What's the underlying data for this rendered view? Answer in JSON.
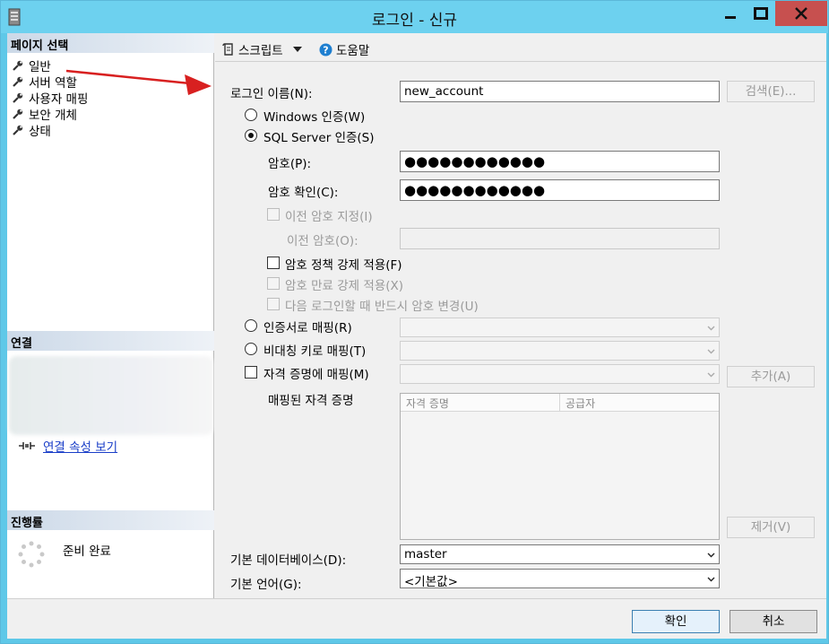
{
  "window": {
    "title": "로그인 - 신규",
    "colors": {
      "titlebar": "#6dd1ef",
      "close": "#c7504f",
      "arrow": "#d82020"
    }
  },
  "left": {
    "page_select_title": "페이지 선택",
    "pages": [
      {
        "label": "일반",
        "icon": "wrench-icon"
      },
      {
        "label": "서버 역할",
        "icon": "wrench-icon"
      },
      {
        "label": "사용자 매핑",
        "icon": "wrench-icon"
      },
      {
        "label": "보안 개체",
        "icon": "wrench-icon"
      },
      {
        "label": "상태",
        "icon": "wrench-icon"
      }
    ],
    "connection_title": "연결",
    "view_connection_link": "연결 속성 보기",
    "progress_title": "진행률",
    "progress_status": "준비 완료"
  },
  "toolbar": {
    "script_label": "스크립트",
    "help_label": "도움말"
  },
  "form": {
    "login_name_label": "로그인 이름(N):",
    "login_name_value": "new_account",
    "search_button": "검색(E)...",
    "windows_auth_label": "Windows 인증(W)",
    "sql_auth_label": "SQL Server 인증(S)",
    "password_label": "암호(P):",
    "password_value": "●●●●●●●●●●●●",
    "confirm_label": "암호 확인(C):",
    "confirm_value": "●●●●●●●●●●●●",
    "specify_old_label": "이전 암호 지정(I)",
    "old_password_label": "이전 암호(O):",
    "enforce_policy_label": "암호 정책 강제 적용(F)",
    "enforce_expiration_label": "암호 만료 강제 적용(X)",
    "must_change_label": "다음 로그인할 때 반드시 암호 변경(U)",
    "cert_map_label": "인증서로 매핑(R)",
    "asym_key_label": "비대칭 키로 매핑(T)",
    "credential_map_label": "자격 증명에 매핑(M)",
    "add_button": "추가(A)",
    "mapped_credentials_label": "매핑된 자격 증명",
    "grid_col_credential": "자격 증명",
    "grid_col_provider": "공급자",
    "remove_button": "제거(V)",
    "default_db_label": "기본 데이터베이스(D):",
    "default_db_value": "master",
    "default_lang_label": "기본 언어(G):",
    "default_lang_value": "<기본값>"
  },
  "footer": {
    "ok_button": "확인",
    "cancel_button": "취소"
  }
}
